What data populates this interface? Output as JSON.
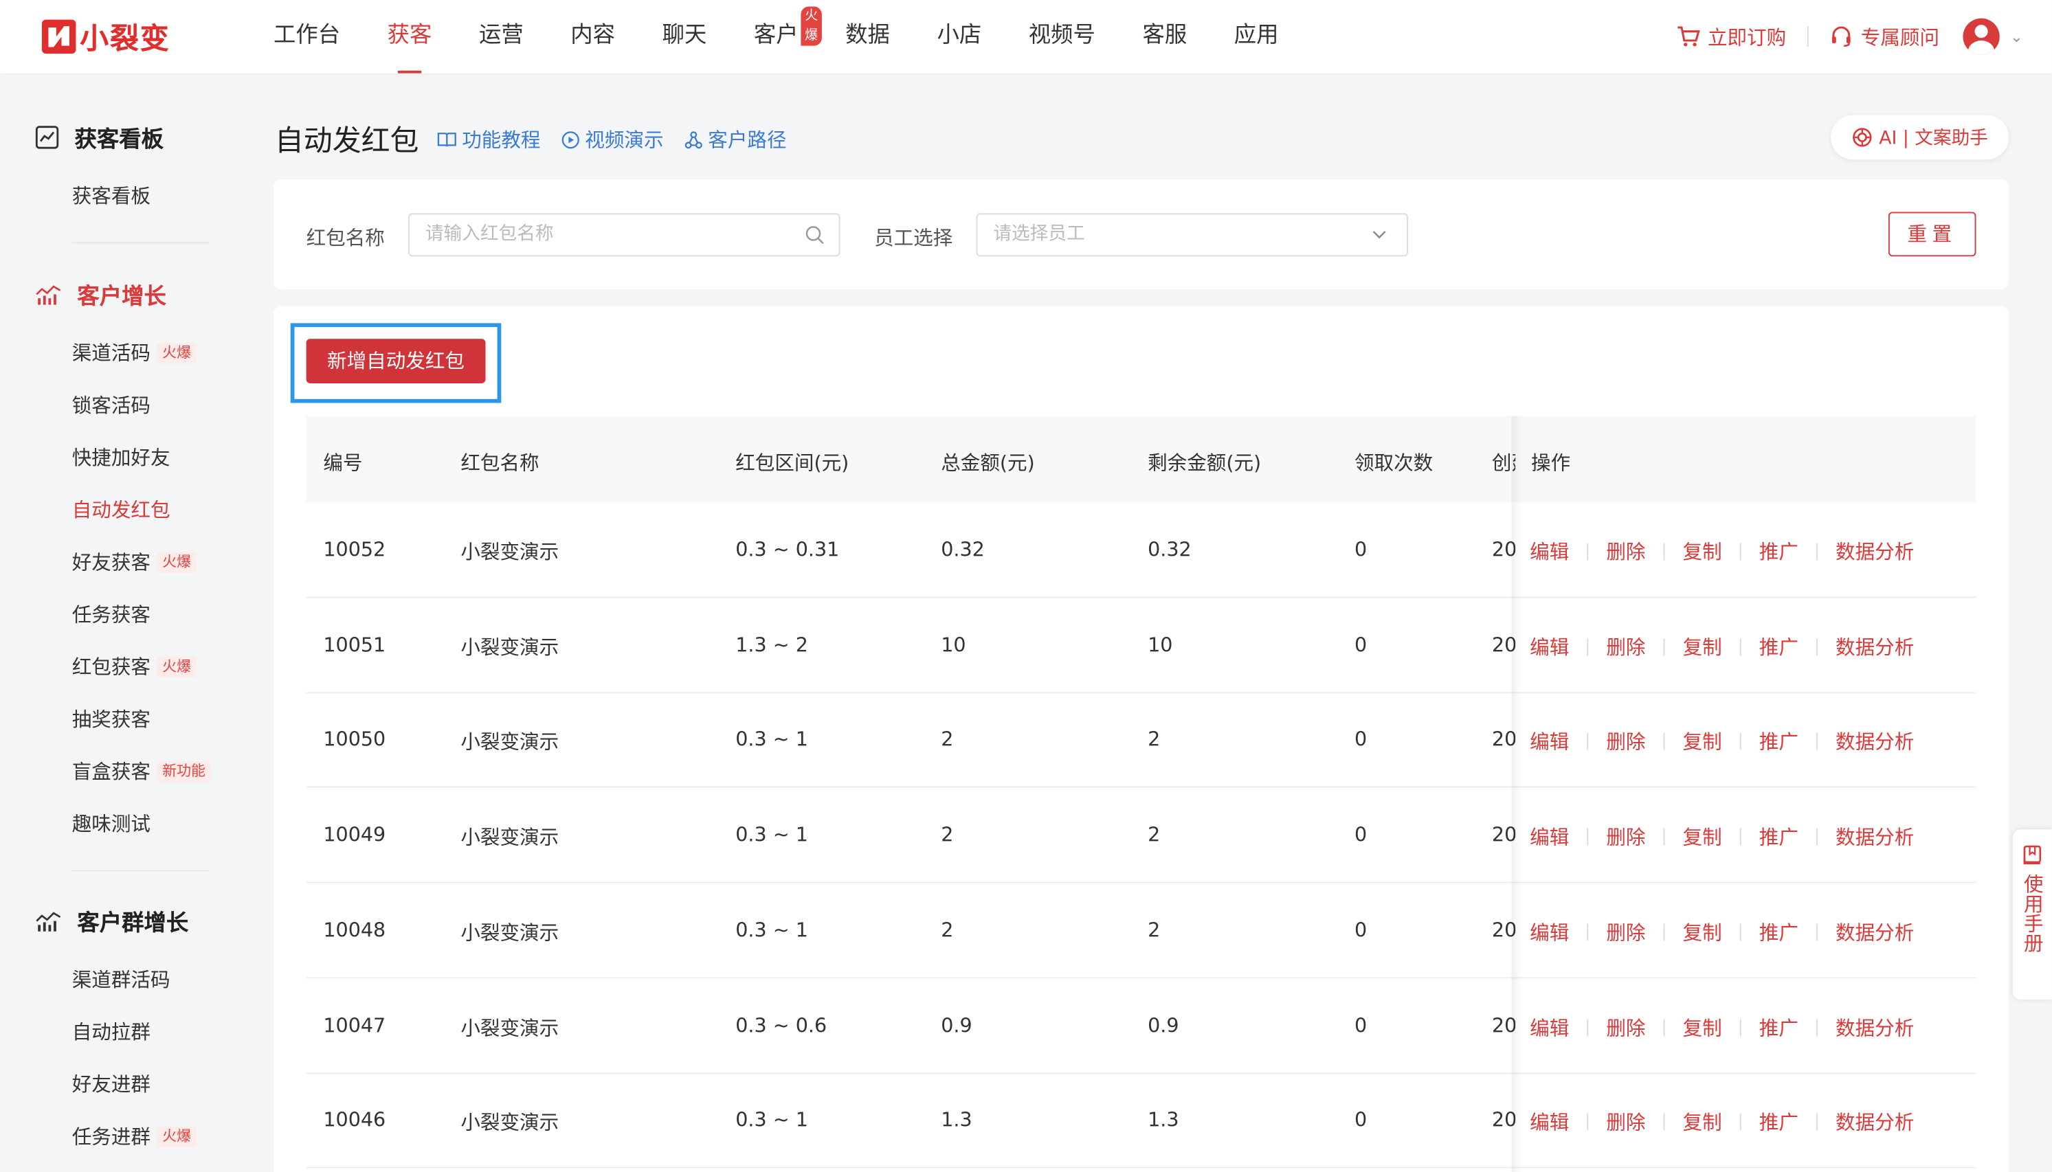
{
  "app": {
    "logo_text": "小裂变",
    "brand_color": "#e02d2d"
  },
  "nav": {
    "items": [
      {
        "label": "工作台"
      },
      {
        "label": "获客"
      },
      {
        "label": "运营"
      },
      {
        "label": "内容"
      },
      {
        "label": "聊天"
      },
      {
        "label": "客户",
        "badge": "火爆"
      },
      {
        "label": "数据"
      },
      {
        "label": "小店"
      },
      {
        "label": "视频号"
      },
      {
        "label": "客服"
      },
      {
        "label": "应用"
      }
    ],
    "active": "获客",
    "buy_label": "立即订购",
    "advisor_label": "专属顾问"
  },
  "sidebar": {
    "group1": {
      "title": "获客看板",
      "items": [
        {
          "label": "获客看板"
        }
      ]
    },
    "group2": {
      "title": "客户增长",
      "items": [
        {
          "label": "渠道活码",
          "tag": "火爆"
        },
        {
          "label": "锁客活码"
        },
        {
          "label": "快捷加好友"
        },
        {
          "label": "自动发红包"
        },
        {
          "label": "好友获客",
          "tag": "火爆"
        },
        {
          "label": "任务获客"
        },
        {
          "label": "红包获客",
          "tag": "火爆"
        },
        {
          "label": "抽奖获客"
        },
        {
          "label": "盲盒获客",
          "tag": "新功能"
        },
        {
          "label": "趣味测试"
        }
      ]
    },
    "group3": {
      "title": "客户群增长",
      "items": [
        {
          "label": "渠道群活码"
        },
        {
          "label": "自动拉群"
        },
        {
          "label": "好友进群"
        },
        {
          "label": "任务进群",
          "tag": "火爆"
        }
      ]
    }
  },
  "page": {
    "title": "自动发红包",
    "links": {
      "tutorial": "功能教程",
      "video": "视频演示",
      "path": "客户路径"
    },
    "ai_label": "AI | 文案助手"
  },
  "filters": {
    "name_label": "红包名称",
    "name_placeholder": "请输入红包名称",
    "staff_label": "员工选择",
    "staff_placeholder": "请选择员工",
    "reset_label": "重置"
  },
  "table": {
    "add_button": "新增自动发红包",
    "columns": {
      "id": "编号",
      "name": "红包名称",
      "range": "红包区间(元)",
      "total": "总金额(元)",
      "remain": "剩余金额(元)",
      "count": "领取次数",
      "created": "创建",
      "ops": "操作"
    },
    "op_labels": {
      "edit": "编辑",
      "delete": "删除",
      "copy": "复制",
      "promote": "推广",
      "analyze": "数据分析"
    },
    "rows": [
      {
        "id": "10052",
        "name": "小裂变演示",
        "range": "0.3 ~ 0.31",
        "total": "0.32",
        "remain": "0.32",
        "count": "0",
        "created": "20"
      },
      {
        "id": "10051",
        "name": "小裂变演示",
        "range": "1.3 ~ 2",
        "total": "10",
        "remain": "10",
        "count": "0",
        "created": "20"
      },
      {
        "id": "10050",
        "name": "小裂变演示",
        "range": "0.3 ~ 1",
        "total": "2",
        "remain": "2",
        "count": "0",
        "created": "20"
      },
      {
        "id": "10049",
        "name": "小裂变演示",
        "range": "0.3 ~ 1",
        "total": "2",
        "remain": "2",
        "count": "0",
        "created": "20"
      },
      {
        "id": "10048",
        "name": "小裂变演示",
        "range": "0.3 ~ 1",
        "total": "2",
        "remain": "2",
        "count": "0",
        "created": "20"
      },
      {
        "id": "10047",
        "name": "小裂变演示",
        "range": "0.3 ~ 0.6",
        "total": "0.9",
        "remain": "0.9",
        "count": "0",
        "created": "20"
      },
      {
        "id": "10046",
        "name": "小裂变演示",
        "range": "0.3 ~ 1",
        "total": "1.3",
        "remain": "1.3",
        "count": "0",
        "created": "20"
      }
    ]
  },
  "manual": {
    "label": "使用手册"
  }
}
